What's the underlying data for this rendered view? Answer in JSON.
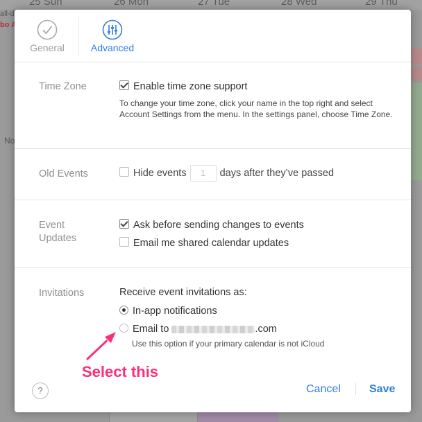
{
  "background": {
    "days": [
      {
        "num": "25",
        "name": "Sun"
      },
      {
        "num": "26",
        "name": "Mon"
      },
      {
        "num": "27",
        "name": "Tue"
      },
      {
        "num": "28",
        "name": "Wed"
      },
      {
        "num": "29",
        "name": "Thu"
      }
    ],
    "allday": "all-d",
    "red_text": "bo A",
    "side_text": "No"
  },
  "tabs": [
    {
      "label": "General",
      "icon": "checkmark-circle-icon",
      "active": false
    },
    {
      "label": "Advanced",
      "icon": "sliders-icon",
      "active": true
    }
  ],
  "sections": {
    "timezone": {
      "label": "Time Zone",
      "checkbox_label": "Enable time zone support",
      "checked": true,
      "help": "To change your time zone, click your name in the top right and select Account Settings from the menu. In the settings panel, choose Time Zone."
    },
    "old_events": {
      "label": "Old Events",
      "prefix": "Hide events",
      "days_value": "1",
      "suffix": "days after they’ve passed",
      "checked": false
    },
    "event_updates": {
      "label": "Event Updates",
      "label_line1": "Event",
      "label_line2": "Updates",
      "option1": "Ask before sending changes to events",
      "option1_checked": true,
      "option2": "Email me shared calendar updates",
      "option2_checked": false
    },
    "invitations": {
      "label": "Invitations",
      "heading": "Receive event invitations as:",
      "option_inapp": "In-app notifications",
      "option_email_prefix": "Email to",
      "option_email_suffix": ".com",
      "note": "Use this option if your primary calendar is not iCloud",
      "selected": "In-app notifications"
    }
  },
  "footer": {
    "help_label": "?",
    "cancel_label": "Cancel",
    "save_label": "Save"
  },
  "annotation": {
    "text": "Select this",
    "color": "#ff2d7a"
  },
  "colors": {
    "accent": "#2f7de1",
    "label_grey": "#8f8f8f"
  }
}
